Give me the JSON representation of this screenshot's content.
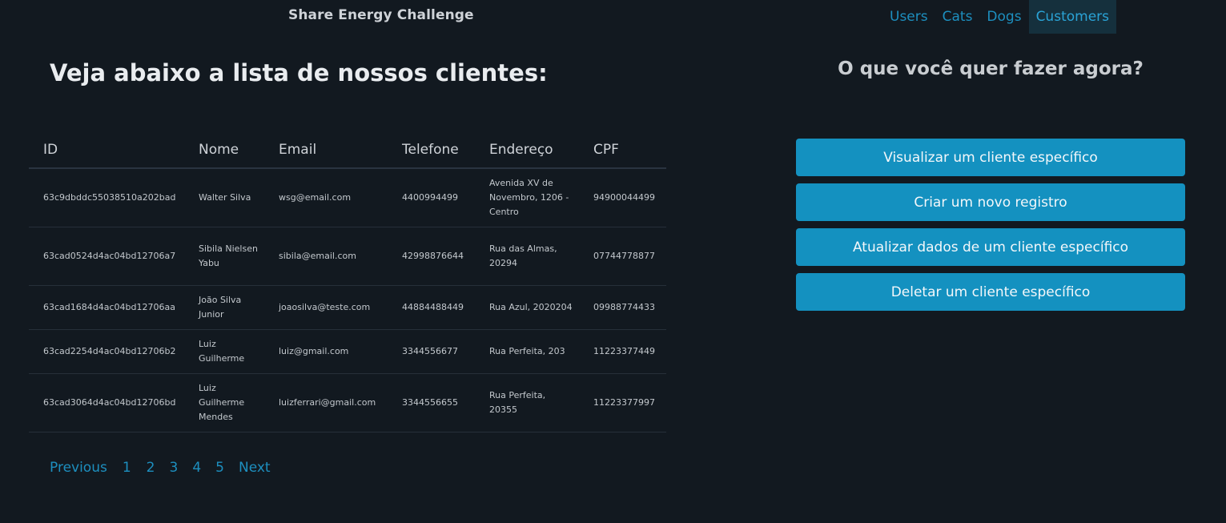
{
  "header": {
    "brand": "Share Energy Challenge",
    "nav": [
      "Users",
      "Cats",
      "Dogs",
      "Customers"
    ],
    "active_nav": "Customers"
  },
  "main": {
    "title": "Veja abaixo a lista de nossos clientes:",
    "table": {
      "headers": [
        "ID",
        "Nome",
        "Email",
        "Telefone",
        "Endereço",
        "CPF"
      ],
      "rows": [
        [
          "63c9dbddc55038510a202bad",
          "Walter Silva",
          "wsg@email.com",
          "4400994499",
          "Avenida XV de Novembro, 1206 - Centro",
          "94900044499"
        ],
        [
          "63cad0524d4ac04bd12706a7",
          "Sibila Nielsen Yabu",
          "sibila@email.com",
          "42998876644",
          "Rua das Almas, 20294",
          "07744778877"
        ],
        [
          "63cad1684d4ac04bd12706aa",
          "João Silva Junior",
          "joaosilva@teste.com",
          "44884488449",
          "Rua Azul, 2020204",
          "09988774433"
        ],
        [
          "63cad2254d4ac04bd12706b2",
          "Luiz Guilherme",
          "luiz@gmail.com",
          "3344556677",
          "Rua Perfeita, 203",
          "11223377449"
        ],
        [
          "63cad3064d4ac04bd12706bd",
          "Luiz Guilherme Mendes",
          "luizferrari@gmail.com",
          "3344556655",
          "Rua Perfeita, 20355",
          "11223377997"
        ]
      ]
    },
    "pagination": {
      "previous": "Previous",
      "pages": [
        "1",
        "2",
        "3",
        "4",
        "5"
      ],
      "next": "Next"
    }
  },
  "sidebar": {
    "title": "O que você quer fazer agora?",
    "actions": [
      "Visualizar um cliente específico",
      "Criar um novo registro",
      "Atualizar dados de um cliente específico",
      "Deletar um cliente específico"
    ]
  },
  "colors": {
    "background": "#121920",
    "accent": "#1491c0",
    "link": "#1d8fbf"
  }
}
